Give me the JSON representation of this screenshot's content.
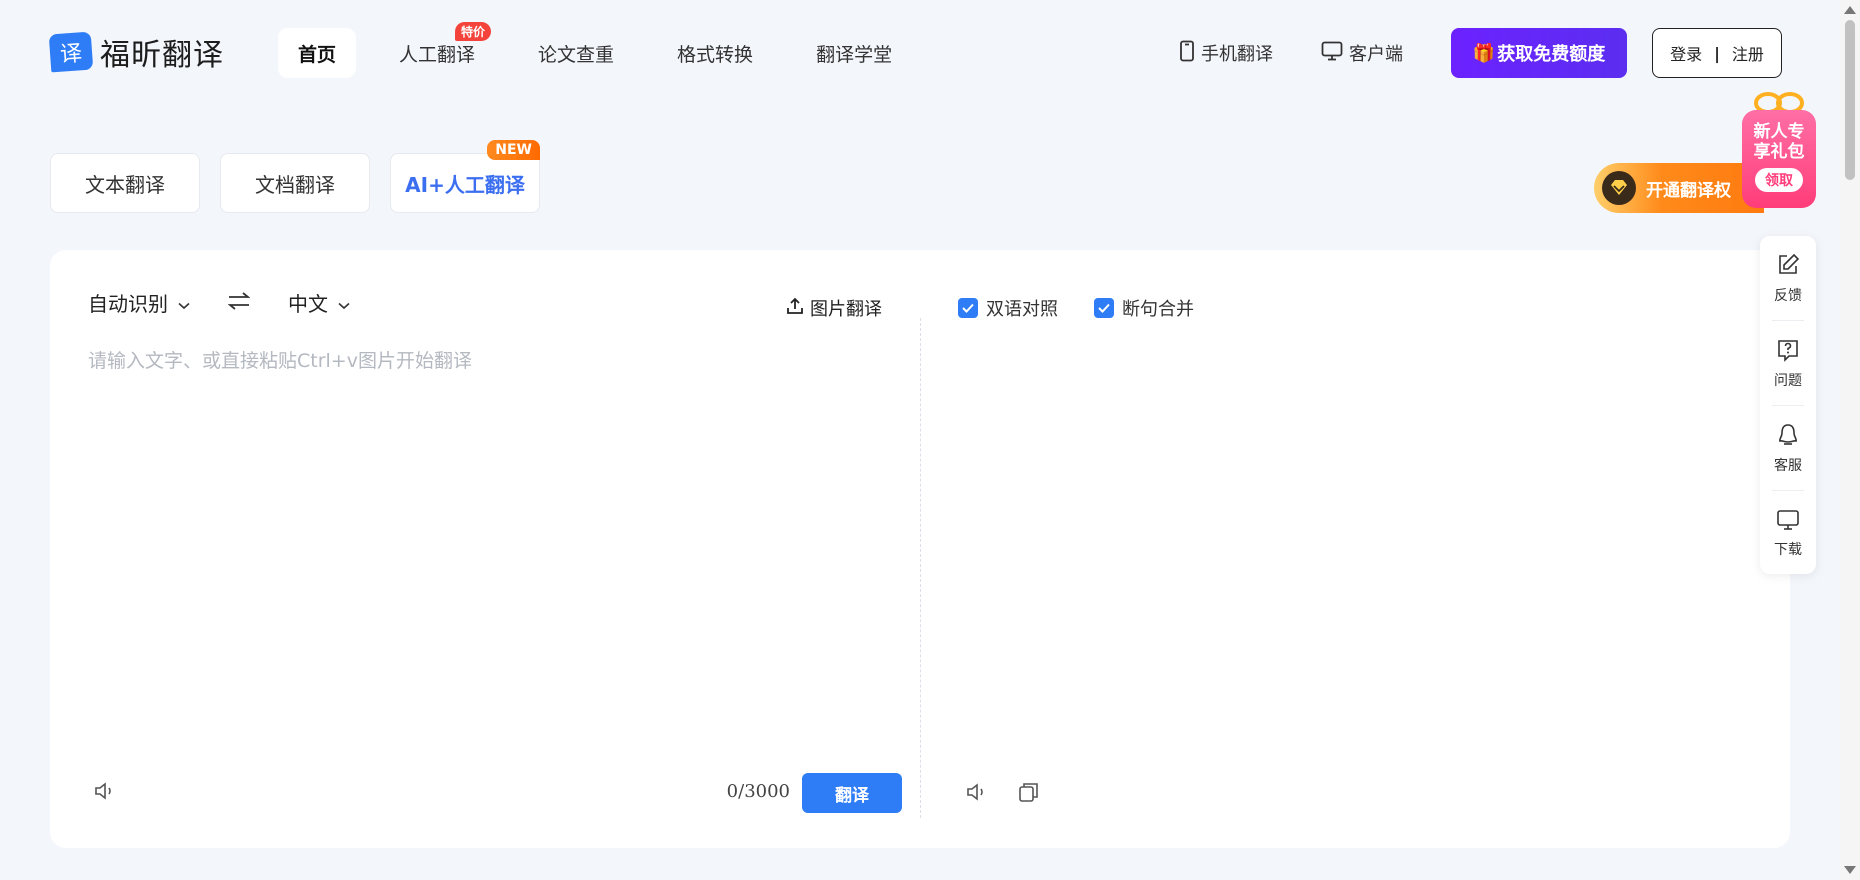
{
  "brand": {
    "logo_glyph": "译",
    "name": "福昕翻译"
  },
  "nav": {
    "items": [
      {
        "label": "首页",
        "active": true
      },
      {
        "label": "人工翻译",
        "badge": "特价"
      },
      {
        "label": "论文查重"
      },
      {
        "label": "格式转换"
      },
      {
        "label": "翻译学堂"
      }
    ]
  },
  "header_right": {
    "mobile_label": "手机翻译",
    "desktop_label": "客户端",
    "promo_label": "获取免费额度",
    "login_label": "登录",
    "register_label": "注册"
  },
  "mode_tabs": [
    {
      "label": "文本翻译"
    },
    {
      "label": "文档翻译"
    },
    {
      "label": "AI+人工翻译",
      "badge": "NEW"
    }
  ],
  "source": {
    "lang": "自动识别",
    "target_lang": "中文",
    "image_translate_label": "图片翻译",
    "placeholder": "请输入文字、或直接粘贴Ctrl+v图片开始翻译",
    "value": "",
    "counter": "0/3000",
    "translate_label": "翻译"
  },
  "target": {
    "options": [
      {
        "label": "双语对照",
        "checked": true
      },
      {
        "label": "断句合并",
        "checked": true
      }
    ]
  },
  "float_bar": [
    {
      "label": "反馈",
      "icon": "edit-icon"
    },
    {
      "label": "问题",
      "icon": "question-icon"
    },
    {
      "label": "客服",
      "icon": "support-icon"
    },
    {
      "label": "下载",
      "icon": "monitor-icon"
    }
  ],
  "promo": {
    "vip_text": "开通翻译权",
    "gift_title": "新人专享礼包",
    "gift_button": "领取"
  },
  "colors": {
    "accent": "#2e7cf6",
    "promo_purple": "#6c22ff",
    "badge_red": "#f4433a"
  }
}
